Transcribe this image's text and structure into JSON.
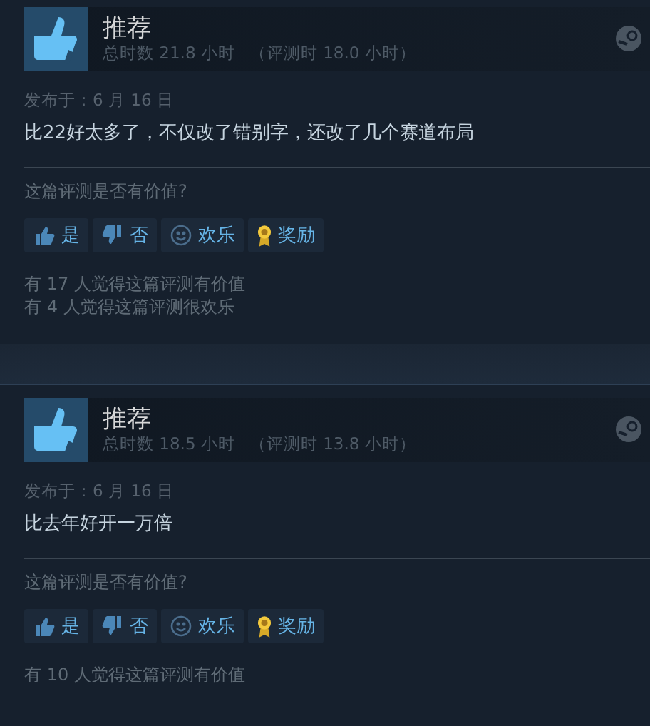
{
  "reviews": [
    {
      "verdict": "推荐",
      "hours": "总时数 21.8 小时",
      "review_hours": "（评测时 18.0 小时）",
      "posted": "发布于：6 月 16 日",
      "text": "比22好太多了，不仅改了错别字，还改了几个赛道布局",
      "question": "这篇评测是否有价值?",
      "buttons": [
        {
          "kind": "yes",
          "label": "是"
        },
        {
          "kind": "no",
          "label": "否"
        },
        {
          "kind": "funny",
          "label": "欢乐"
        },
        {
          "kind": "award",
          "label": "奖励"
        }
      ],
      "stats": [
        "有 17 人觉得这篇评测有价值",
        "有 4 人觉得这篇评测很欢乐"
      ]
    },
    {
      "verdict": "推荐",
      "hours": "总时数 18.5 小时",
      "review_hours": "（评测时 13.8 小时）",
      "posted": "发布于：6 月 16 日",
      "text": "比去年好开一万倍",
      "question": "这篇评测是否有价值?",
      "buttons": [
        {
          "kind": "yes",
          "label": "是"
        },
        {
          "kind": "no",
          "label": "否"
        },
        {
          "kind": "funny",
          "label": "欢乐"
        },
        {
          "kind": "award",
          "label": "奖励"
        }
      ],
      "stats": [
        "有 10 人觉得这篇评测有价值"
      ]
    }
  ]
}
